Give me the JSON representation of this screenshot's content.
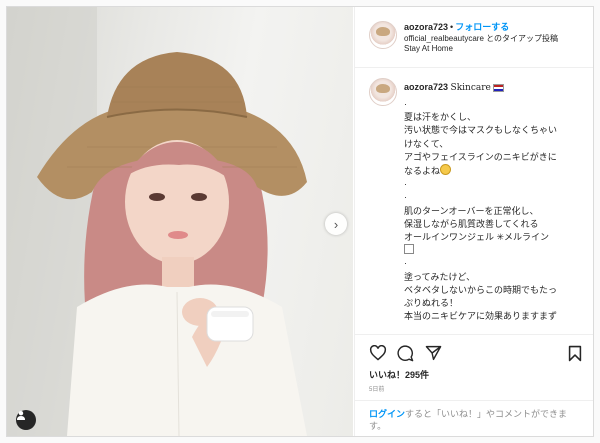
{
  "post": {
    "username": "aozora723",
    "dot": "•",
    "follow_label": "フォローする",
    "sponsor_text": "official_realbeautycare とのタイアップ投稿",
    "location": "Stay At Home"
  },
  "caption": {
    "username": "aozora723",
    "title": "Skincare",
    "lines": [
      "·",
      "夏は汗をかくし、",
      "汚い状態で今はマスクもしなくちゃい",
      "けなくて、",
      "アゴやフェイスラインのニキビがきに",
      "なるよね",
      "·",
      "·",
      "肌のターンオーバーを正常化し、",
      "保湿しながら肌質改善してくれる",
      "オールインワンジェル ✳︎メルライン",
      "",
      "·",
      "塗ってみたけど、",
      "ベタベタしないからこの時期でもたっ",
      "ぷりぬれる！",
      "本当のニキビケアに効果ありますまず"
    ]
  },
  "likes_text": "いいね！295件",
  "posted_time": "5日前",
  "footer": {
    "login_label": "ログイン",
    "rest_text": "すると「いいね！」やコメントができます。"
  },
  "icons": [
    "heart-icon",
    "comment-icon",
    "share-icon",
    "bookmark-icon",
    "chevron-right-icon",
    "user-tag-icon"
  ],
  "colors": {
    "accent": "#0095f6",
    "text": "#262626",
    "muted": "#8e8e8e",
    "hair": "#c98a86",
    "hat": "#b38f63"
  }
}
